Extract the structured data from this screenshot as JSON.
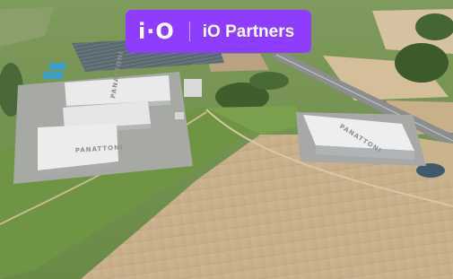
{
  "badge": {
    "mark": "i·O",
    "name": "iO Partners",
    "background": "#8e3dff"
  },
  "roof_labels": {
    "building_left": "PANATTONI",
    "building_center": "PANATTONI",
    "building_right": "PANATTONI"
  }
}
